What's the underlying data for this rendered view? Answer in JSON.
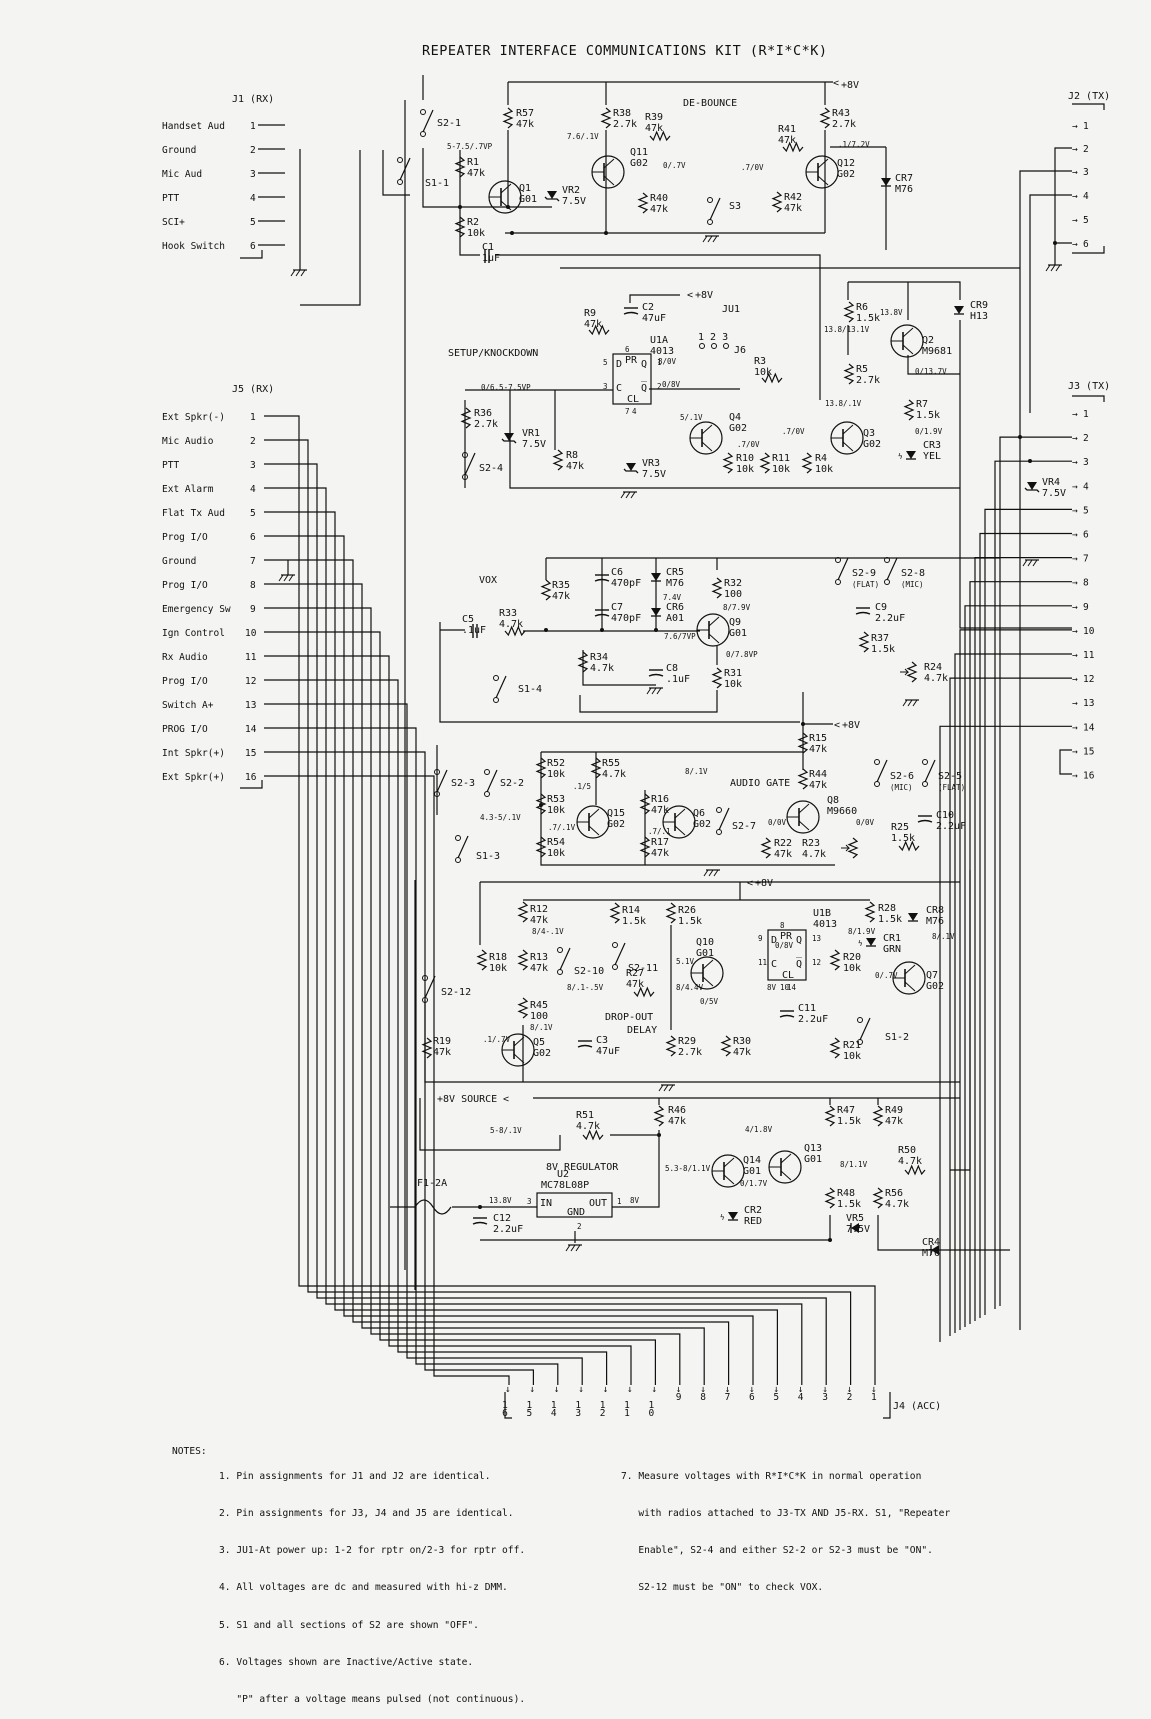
{
  "title": "REPEATER INTERFACE COMMUNICATIONS KIT  (R*I*C*K)",
  "connectors": {
    "j1": {
      "label": "J1 (RX)",
      "pins": [
        {
          "num": "1",
          "name": "Handset Aud"
        },
        {
          "num": "2",
          "name": "Ground"
        },
        {
          "num": "3",
          "name": "Mic Aud"
        },
        {
          "num": "4",
          "name": "PTT"
        },
        {
          "num": "5",
          "name": "SCI+"
        },
        {
          "num": "6",
          "name": "Hook Switch"
        }
      ]
    },
    "j5": {
      "label": "J5 (RX)",
      "pins": [
        {
          "num": "1",
          "name": "Ext Spkr(-)"
        },
        {
          "num": "2",
          "name": "Mic Audio"
        },
        {
          "num": "3",
          "name": "PTT"
        },
        {
          "num": "4",
          "name": "Ext Alarm"
        },
        {
          "num": "5",
          "name": "Flat Tx Aud"
        },
        {
          "num": "6",
          "name": "Prog I/O"
        },
        {
          "num": "7",
          "name": "Ground"
        },
        {
          "num": "8",
          "name": "Prog I/O"
        },
        {
          "num": "9",
          "name": "Emergency Sw"
        },
        {
          "num": "10",
          "name": "Ign Control"
        },
        {
          "num": "11",
          "name": "Rx Audio"
        },
        {
          "num": "12",
          "name": "Prog I/O"
        },
        {
          "num": "13",
          "name": "Switch A+"
        },
        {
          "num": "14",
          "name": "PROG I/O"
        },
        {
          "num": "15",
          "name": "Int Spkr(+)"
        },
        {
          "num": "16",
          "name": "Ext Spkr(+)"
        }
      ]
    },
    "j2": {
      "label": "J2 (TX)",
      "pins": [
        "1",
        "2",
        "3",
        "4",
        "5",
        "6"
      ]
    },
    "j3": {
      "label": "J3 (TX)",
      "pins": [
        "1",
        "2",
        "3",
        "4",
        "5",
        "6",
        "7",
        "8",
        "9",
        "10",
        "11",
        "12",
        "13",
        "14",
        "15",
        "16"
      ]
    },
    "j4": {
      "label": "J4 (ACC)",
      "pins": [
        "16",
        "15",
        "14",
        "13",
        "12",
        "11",
        "10",
        "9",
        "8",
        "7",
        "6",
        "5",
        "4",
        "3",
        "2",
        "1"
      ]
    }
  },
  "sections": {
    "debounce": "DE-BOUNCE",
    "setup": "SETUP/KNOCKDOWN",
    "vox": "VOX",
    "audio_gate": "AUDIO GATE",
    "dropout": [
      "DROP-OUT",
      "DELAY"
    ],
    "regulator": "8V REGULATOR",
    "source": "+8V SOURCE",
    "supply": "+8V"
  },
  "components": [
    {
      "ref": "R57",
      "value": "47k",
      "kind": "resistor"
    },
    {
      "ref": "R38",
      "value": "2.7k",
      "kind": "resistor"
    },
    {
      "ref": "R39",
      "value": "47k",
      "kind": "resistor"
    },
    {
      "ref": "R43",
      "value": "2.7k",
      "kind": "resistor"
    },
    {
      "ref": "R41",
      "value": "47k",
      "kind": "resistor"
    },
    {
      "ref": "R1",
      "value": "47k",
      "kind": "resistor"
    },
    {
      "ref": "R2",
      "value": "10k",
      "kind": "resistor"
    },
    {
      "ref": "R40",
      "value": "47k",
      "kind": "resistor"
    },
    {
      "ref": "R42",
      "value": "47k",
      "kind": "resistor"
    },
    {
      "ref": "R6",
      "value": "1.5k",
      "kind": "resistor"
    },
    {
      "ref": "R5",
      "value": "2.7k",
      "kind": "resistor"
    },
    {
      "ref": "R7",
      "value": "1.5k",
      "kind": "resistor"
    },
    {
      "ref": "R9",
      "value": "47k",
      "kind": "resistor"
    },
    {
      "ref": "R3",
      "value": "10k",
      "kind": "resistor"
    },
    {
      "ref": "R36",
      "value": "2.7k",
      "kind": "resistor"
    },
    {
      "ref": "R8",
      "value": "47k",
      "kind": "resistor"
    },
    {
      "ref": "R10",
      "value": "10k",
      "kind": "resistor"
    },
    {
      "ref": "R11",
      "value": "10k",
      "kind": "resistor"
    },
    {
      "ref": "R4",
      "value": "10k",
      "kind": "resistor"
    },
    {
      "ref": "R35",
      "value": "47k",
      "kind": "resistor"
    },
    {
      "ref": "R33",
      "value": "4.7k",
      "kind": "resistor"
    },
    {
      "ref": "R34",
      "value": "4.7k",
      "kind": "resistor"
    },
    {
      "ref": "R32",
      "value": "100",
      "kind": "resistor"
    },
    {
      "ref": "R31",
      "value": "10k",
      "kind": "resistor"
    },
    {
      "ref": "R37",
      "value": "1.5k",
      "kind": "resistor"
    },
    {
      "ref": "R24",
      "value": "4.7k",
      "kind": "pot"
    },
    {
      "ref": "R15",
      "value": "47k",
      "kind": "resistor"
    },
    {
      "ref": "R44",
      "value": "47k",
      "kind": "resistor"
    },
    {
      "ref": "R52",
      "value": "10k",
      "kind": "resistor"
    },
    {
      "ref": "R53",
      "value": "10k",
      "kind": "resistor"
    },
    {
      "ref": "R54",
      "value": "10k",
      "kind": "resistor"
    },
    {
      "ref": "R55",
      "value": "4.7k",
      "kind": "resistor"
    },
    {
      "ref": "R16",
      "value": "47k",
      "kind": "resistor"
    },
    {
      "ref": "R17",
      "value": "47k",
      "kind": "resistor"
    },
    {
      "ref": "R22",
      "value": "47k",
      "kind": "resistor"
    },
    {
      "ref": "R23",
      "value": "4.7k",
      "kind": "pot"
    },
    {
      "ref": "R25",
      "value": "1.5k",
      "kind": "resistor"
    },
    {
      "ref": "R12",
      "value": "47k",
      "kind": "resistor"
    },
    {
      "ref": "R13",
      "value": "47k",
      "kind": "resistor"
    },
    {
      "ref": "R45",
      "value": "100",
      "kind": "resistor"
    },
    {
      "ref": "R18",
      "value": "10k",
      "kind": "resistor"
    },
    {
      "ref": "R19",
      "value": "47k",
      "kind": "resistor"
    },
    {
      "ref": "R14",
      "value": "1.5k",
      "kind": "resistor"
    },
    {
      "ref": "R26",
      "value": "1.5k",
      "kind": "resistor"
    },
    {
      "ref": "R27",
      "value": "47k",
      "kind": "resistor"
    },
    {
      "ref": "R29",
      "value": "2.7k",
      "kind": "resistor"
    },
    {
      "ref": "R30",
      "value": "47k",
      "kind": "resistor"
    },
    {
      "ref": "R28",
      "value": "1.5k",
      "kind": "resistor"
    },
    {
      "ref": "R20",
      "value": "10k",
      "kind": "resistor"
    },
    {
      "ref": "R21",
      "value": "10k",
      "kind": "resistor"
    },
    {
      "ref": "R46",
      "value": "47k",
      "kind": "resistor"
    },
    {
      "ref": "R47",
      "value": "1.5k",
      "kind": "resistor"
    },
    {
      "ref": "R49",
      "value": "47k",
      "kind": "resistor"
    },
    {
      "ref": "R48",
      "value": "1.5k",
      "kind": "resistor"
    },
    {
      "ref": "R56",
      "value": "4.7k",
      "kind": "resistor"
    },
    {
      "ref": "R51",
      "value": "4.7k",
      "kind": "resistor"
    },
    {
      "ref": "R50",
      "value": "4.7k",
      "kind": "resistor"
    },
    {
      "ref": "C1",
      "value": "1uF",
      "kind": "capacitor"
    },
    {
      "ref": "C2",
      "value": "47uF",
      "kind": "capacitor"
    },
    {
      "ref": "C5",
      "value": ".1uF",
      "kind": "capacitor"
    },
    {
      "ref": "C6",
      "value": "470pF",
      "kind": "capacitor"
    },
    {
      "ref": "C7",
      "value": "470pF",
      "kind": "capacitor"
    },
    {
      "ref": "C8",
      "value": ".1uF",
      "kind": "capacitor"
    },
    {
      "ref": "C9",
      "value": "2.2uF",
      "kind": "capacitor"
    },
    {
      "ref": "C10",
      "value": "2.2uF",
      "kind": "capacitor"
    },
    {
      "ref": "C3",
      "value": "47uF",
      "kind": "capacitor"
    },
    {
      "ref": "C11",
      "value": "2.2uF",
      "kind": "capacitor"
    },
    {
      "ref": "C12",
      "value": "2.2uF",
      "kind": "capacitor"
    },
    {
      "ref": "VR2",
      "value": "7.5V",
      "kind": "zener"
    },
    {
      "ref": "VR1",
      "value": "7.5V",
      "kind": "zener"
    },
    {
      "ref": "VR3",
      "value": "7.5V",
      "kind": "zener"
    },
    {
      "ref": "VR4",
      "value": "7.5V",
      "kind": "zener"
    },
    {
      "ref": "VR5",
      "value": "7.5V",
      "kind": "zener"
    },
    {
      "ref": "CR7",
      "value": "M76",
      "kind": "diode"
    },
    {
      "ref": "CR9",
      "value": "H13",
      "kind": "diode"
    },
    {
      "ref": "CR3",
      "value": "YEL",
      "kind": "led"
    },
    {
      "ref": "CR5",
      "value": "M76",
      "kind": "diode"
    },
    {
      "ref": "CR6",
      "value": "A01",
      "kind": "diode"
    },
    {
      "ref": "CR1",
      "value": "GRN",
      "kind": "led"
    },
    {
      "ref": "CR8",
      "value": "M76",
      "kind": "diode"
    },
    {
      "ref": "CR2",
      "value": "RED",
      "kind": "led"
    },
    {
      "ref": "CR4",
      "value": "M76",
      "kind": "diode"
    },
    {
      "ref": "Q1",
      "value": "G01",
      "kind": "transistor"
    },
    {
      "ref": "Q11",
      "value": "G02",
      "kind": "transistor"
    },
    {
      "ref": "Q12",
      "value": "G02",
      "kind": "transistor"
    },
    {
      "ref": "Q2",
      "value": "M9681",
      "kind": "transistor"
    },
    {
      "ref": "Q4",
      "value": "G02",
      "kind": "transistor"
    },
    {
      "ref": "Q3",
      "value": "G02",
      "kind": "transistor"
    },
    {
      "ref": "Q9",
      "value": "G01",
      "kind": "transistor"
    },
    {
      "ref": "Q15",
      "value": "G02",
      "kind": "transistor"
    },
    {
      "ref": "Q6",
      "value": "G02",
      "kind": "transistor"
    },
    {
      "ref": "Q8",
      "value": "M9660",
      "kind": "fet"
    },
    {
      "ref": "Q10",
      "value": "G01",
      "kind": "transistor"
    },
    {
      "ref": "Q5",
      "value": "G02",
      "kind": "transistor"
    },
    {
      "ref": "Q7",
      "value": "G02",
      "kind": "transistor"
    },
    {
      "ref": "Q14",
      "value": "G01",
      "kind": "transistor"
    },
    {
      "ref": "Q13",
      "value": "G01",
      "kind": "transistor"
    },
    {
      "ref": "U1A",
      "value": "4013",
      "kind": "ic",
      "pins": [
        "D",
        "C",
        "PR",
        "CL",
        "Q",
        "Q̅"
      ],
      "pin_numbers": [
        "5",
        "3",
        "6",
        "7",
        "4",
        "1",
        "2"
      ]
    },
    {
      "ref": "U1B",
      "value": "4013",
      "kind": "ic",
      "pins": [
        "D",
        "C",
        "PR",
        "CL",
        "Q",
        "Q̅"
      ],
      "pin_numbers": [
        "9",
        "11",
        "8",
        "10",
        "14",
        "13",
        "12"
      ]
    },
    {
      "ref": "U2",
      "value": "MC78L08P",
      "kind": "regulator",
      "pins": [
        "IN",
        "OUT",
        "GND"
      ],
      "pin_numbers": [
        "3",
        "1",
        "2"
      ]
    },
    {
      "ref": "F1-2A",
      "value": "",
      "kind": "fuse"
    },
    {
      "ref": "JU1",
      "value": "1  2  3",
      "kind": "jumper"
    }
  ],
  "jumper_label": "J6",
  "switches": [
    {
      "ref": "S2-1"
    },
    {
      "ref": "S1-1"
    },
    {
      "ref": "S3"
    },
    {
      "ref": "S2-4"
    },
    {
      "ref": "S2-9",
      "sub": "(FLAT)"
    },
    {
      "ref": "S2-8",
      "sub": "(MIC)"
    },
    {
      "ref": "S1-4"
    },
    {
      "ref": "S2-3"
    },
    {
      "ref": "S2-2"
    },
    {
      "ref": "S1-3"
    },
    {
      "ref": "S2-7"
    },
    {
      "ref": "S2-6",
      "sub": "(MIC)"
    },
    {
      "ref": "S2-5",
      "sub": "(FLAT)"
    },
    {
      "ref": "S2-12"
    },
    {
      "ref": "S2-10"
    },
    {
      "ref": "S2-11"
    },
    {
      "ref": "S1-2"
    }
  ],
  "voltages": [
    "5-7.5/.7VP",
    "7.6/.1V",
    "0/.7V",
    ".7/0V",
    ".1/7.2V",
    "13.8V",
    "13.8/13.1V",
    "0/13.7V",
    "13.8/.1V",
    "0/1.9V",
    "0/6.5-7.5VP",
    "8/0V",
    "0/8V",
    "5/.1V",
    ".7/0V",
    ".7/0V",
    "7.4V",
    "8/7.9V",
    "7.6/7VP",
    "0/7.8VP",
    "8/.1V",
    ".1/5",
    "4.3-5/.1V",
    ".7/.1V",
    ".7/.1",
    "0/0V",
    "0/0V",
    "8/4-.1V",
    "8/.1-.5V",
    "5.1V",
    "8/4.4V",
    "0/5V",
    "8/.1V",
    ".1/.7V",
    "0/8V",
    "8V",
    "8/1.9V",
    "0/.7V",
    "8/.1V",
    "5-8/.1V",
    "4/1.8V",
    "5.3-8/1.1V",
    "0/1.7V",
    "8/1.1V",
    "13.8V",
    "8V"
  ],
  "notes": {
    "heading": "NOTES:",
    "left": [
      "1. Pin assignments for J1 and J2 are identical.",
      "2. Pin assignments for J3, J4 and J5 are identical.",
      "3. JU1-At power up: 1-2 for rptr on/2-3 for rptr off.",
      "4. All voltages are dc and measured with hi-z DMM.",
      "5. S1 and all sections of S2 are shown \"OFF\".",
      "6. Voltages shown are Inactive/Active state.",
      "   \"P\" after a voltage means pulsed (not continuous)."
    ],
    "right": [
      "7. Measure voltages with R*I*C*K in normal operation",
      "   with radios attached to J3-TX AND J5-RX. S1, \"Repeater",
      "   Enable\", S2-4 and either S2-2 or S2-3 must be \"ON\".",
      "   S2-12 must be \"ON\" to check VOX."
    ]
  },
  "colors": {
    "ink": "#111111",
    "paper": "#f4f4f2"
  }
}
